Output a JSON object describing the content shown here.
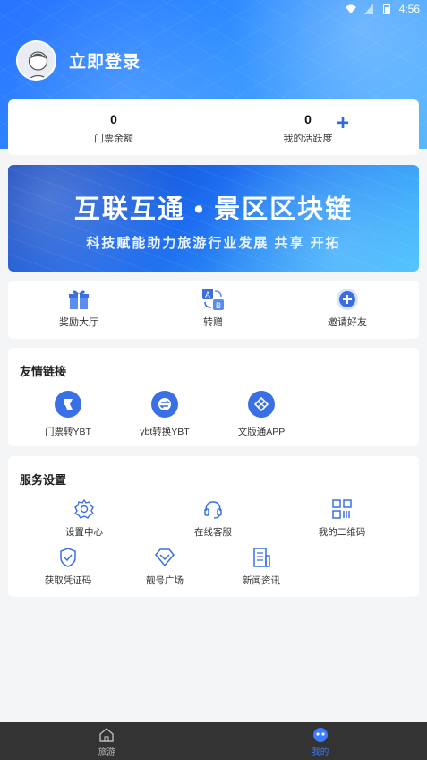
{
  "status": {
    "time": "4:56"
  },
  "profile": {
    "login_label": "立即登录"
  },
  "stats": [
    {
      "value": "0",
      "label": "门票余额"
    },
    {
      "value": "0",
      "label": "我的活跃度"
    }
  ],
  "banner": {
    "headline": "互联互通 • 景区区块链",
    "subline": "科技赋能助力旅游行业发展  共享  开拓"
  },
  "quick_actions": [
    {
      "label": "奖励大厅",
      "icon": "gift-icon"
    },
    {
      "label": "转赠",
      "icon": "transfer-icon"
    },
    {
      "label": "邀请好友",
      "icon": "invite-plus-icon"
    }
  ],
  "links": {
    "title": "友情链接",
    "items": [
      {
        "label": "门票转YBT"
      },
      {
        "label": "ybt转换YBT"
      },
      {
        "label": "文版通APP"
      }
    ]
  },
  "services": {
    "title": "服务设置",
    "items": [
      {
        "label": "设置中心"
      },
      {
        "label": "在线客服"
      },
      {
        "label": "我的二维码"
      },
      {
        "label": "获取凭证码"
      },
      {
        "label": "靓号广场"
      },
      {
        "label": "新闻资讯"
      }
    ]
  },
  "tabs": [
    {
      "label": "旅游",
      "active": false
    },
    {
      "label": "我的",
      "active": true
    }
  ],
  "colors": {
    "accent": "#2d6cdf",
    "tab_active": "#3b7cff"
  }
}
